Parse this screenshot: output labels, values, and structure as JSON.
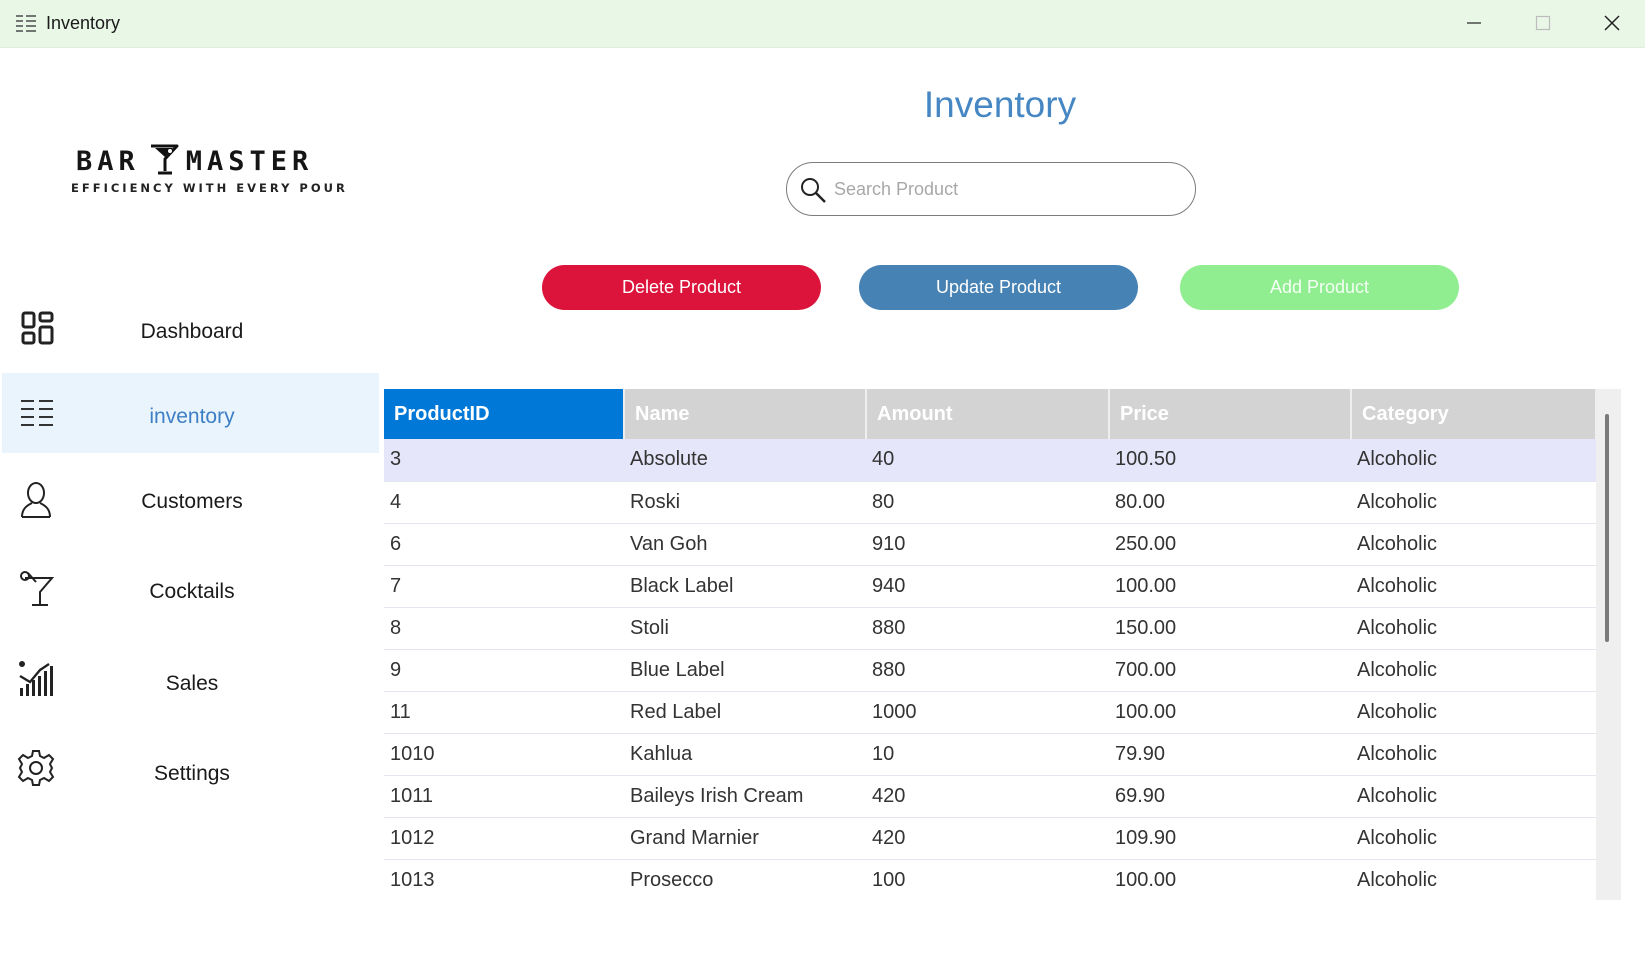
{
  "window": {
    "title": "Inventory",
    "icon": "list-icon",
    "controls": [
      "minimize-icon",
      "maximize-icon",
      "close-icon"
    ]
  },
  "logo": {
    "brand_left": "BAR",
    "brand_right": "MASTER",
    "tagline": "EFFICIENCY WITH EVERY POUR",
    "icon": "cocktail-glass-icon"
  },
  "sidebar": {
    "items": [
      {
        "label": "Dashboard",
        "icon": "dashboard-grid-icon",
        "active": false
      },
      {
        "label": "inventory",
        "icon": "list-icon",
        "active": true
      },
      {
        "label": "Customers",
        "icon": "user-icon",
        "active": false
      },
      {
        "label": "Cocktails",
        "icon": "cocktail-icon",
        "active": false
      },
      {
        "label": "Sales",
        "icon": "chart-bars-icon",
        "active": false
      },
      {
        "label": "Settings",
        "icon": "gear-icon",
        "active": false
      }
    ]
  },
  "main": {
    "title": "Inventory",
    "search": {
      "placeholder": "Search Product",
      "value": ""
    },
    "buttons": {
      "delete": "Delete Product",
      "update": "Update Product",
      "add": "Add Product"
    },
    "table": {
      "columns": [
        "ProductID",
        "Name",
        "Amount",
        "Price",
        "Category"
      ],
      "sorted_column": "ProductID",
      "selected_row": 0,
      "rows": [
        [
          "3",
          "Absolute",
          "40",
          "100.50",
          "Alcoholic"
        ],
        [
          "4",
          "Roski",
          "80",
          "80.00",
          "Alcoholic"
        ],
        [
          "6",
          "Van Goh",
          "910",
          "250.00",
          "Alcoholic"
        ],
        [
          "7",
          "Black Label",
          "940",
          "100.00",
          "Alcoholic"
        ],
        [
          "8",
          "Stoli",
          "880",
          "150.00",
          "Alcoholic"
        ],
        [
          "9",
          "Blue Label",
          "880",
          "700.00",
          "Alcoholic"
        ],
        [
          "11",
          "Red Label",
          "1000",
          "100.00",
          "Alcoholic"
        ],
        [
          "1010",
          "Kahlua",
          "10",
          "79.90",
          "Alcoholic"
        ],
        [
          "1011",
          "Baileys Irish Cream",
          "420",
          "69.90",
          "Alcoholic"
        ],
        [
          "1012",
          "Grand Marnier",
          "420",
          "109.90",
          "Alcoholic"
        ],
        [
          "1013",
          "Prosecco",
          "100",
          "100.00",
          "Alcoholic"
        ]
      ]
    }
  },
  "colors": {
    "titlebar_bg": "#e9f7e6",
    "accent": "#4586c3",
    "delete": "#dc143c",
    "update": "#4682b4",
    "add": "#90ee90",
    "header_sorted": "#0078d7",
    "header": "#d3d3d3",
    "selected_row": "#e6e6fa"
  }
}
